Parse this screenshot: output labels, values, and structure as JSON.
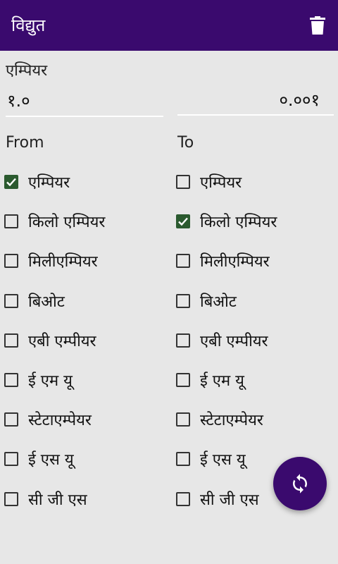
{
  "appbar": {
    "title": "विद्युत",
    "delete_icon": "trash-icon"
  },
  "unit_label": "एम्पियर",
  "input": {
    "from_value": "१.०",
    "to_value": "०.००१"
  },
  "columns": {
    "from_header": "From",
    "to_header": "To"
  },
  "from_units": [
    {
      "label": "एम्पियर",
      "checked": true
    },
    {
      "label": "किलो एम्पियर",
      "checked": false
    },
    {
      "label": "मिलीएम्पियर",
      "checked": false
    },
    {
      "label": "बिओट",
      "checked": false
    },
    {
      "label": "एबी एम्पीयर",
      "checked": false
    },
    {
      "label": "ई एम यू",
      "checked": false
    },
    {
      "label": "स्टेटाएम्पेयर",
      "checked": false
    },
    {
      "label": "ई एस यू",
      "checked": false
    },
    {
      "label": "सी जी एस",
      "checked": false
    }
  ],
  "to_units": [
    {
      "label": "एम्पियर",
      "checked": false
    },
    {
      "label": "किलो एम्पियर",
      "checked": true
    },
    {
      "label": "मिलीएम्पियर",
      "checked": false
    },
    {
      "label": "बिओट",
      "checked": false
    },
    {
      "label": "एबी एम्पीयर",
      "checked": false
    },
    {
      "label": "ई एम यू",
      "checked": false
    },
    {
      "label": "स्टेटाएम्पेयर",
      "checked": false
    },
    {
      "label": "ई एस यू",
      "checked": false
    },
    {
      "label": "सी जी एस",
      "checked": false
    }
  ],
  "fab": {
    "icon": "swap-refresh-icon"
  },
  "colors": {
    "primary": "#3a0a6e",
    "checked": "#2b5a2f",
    "background": "#e7e7e7"
  }
}
